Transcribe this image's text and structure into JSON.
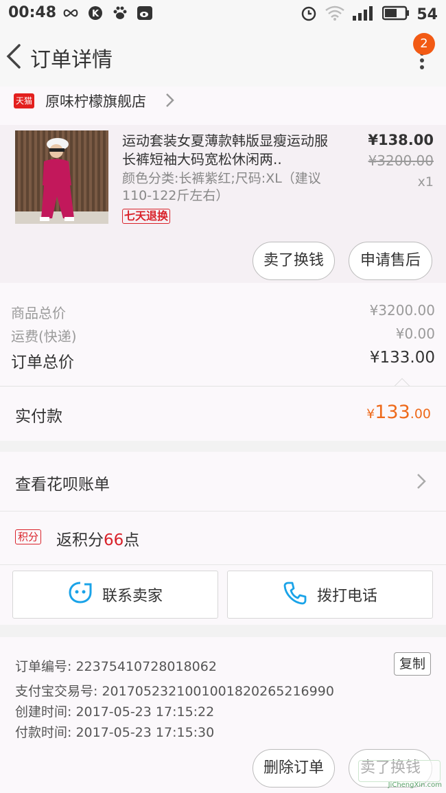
{
  "status": {
    "time": "00:48",
    "battery": "54"
  },
  "header": {
    "title": "订单详情",
    "badge": "2"
  },
  "shop": {
    "logo": "天猫",
    "name": "原味柠檬旗舰店"
  },
  "product": {
    "title": "运动套装女夏薄款韩版显瘦运动服长裤短袖大码宽松休闲两..",
    "sku": "颜色分类:长裤紫红;尺码:XL（建议110-122斤左右）",
    "tag": "七天退换",
    "price": "¥138.00",
    "orig_price": "¥3200.00",
    "qty": "x1",
    "btn_sell": "卖了换钱",
    "btn_aftersale": "申请售后"
  },
  "summary": {
    "goods_label": "商品总价",
    "goods_value": "¥3200.00",
    "ship_label": "运费(快递)",
    "ship_value": "¥0.00",
    "total_label": "订单总价",
    "total_value": "¥133.00"
  },
  "paid": {
    "label": "实付款",
    "yen": "¥",
    "int": "133",
    "dec": ".00"
  },
  "huabei": {
    "label": "查看花呗账单"
  },
  "points": {
    "tag": "积分",
    "prefix": "返积分",
    "num": "66",
    "suffix": "点"
  },
  "contacts": {
    "seller": "联系卖家",
    "call": "拨打电话"
  },
  "info": {
    "order_no": "订单编号: 22375410728018062",
    "alipay_no": "支付宝交易号: 2017052321001001820265216990",
    "created": "创建时间: 2017-05-23 17:15:22",
    "paid": "付款时间: 2017-05-23 17:15:30",
    "copy": "复制"
  },
  "footer": {
    "delete": "删除订单",
    "sell": "卖了换钱"
  },
  "watermark": "JiChengXin.com",
  "colors": {
    "accent": "#ee6a1b",
    "tmall_red": "#d9222a",
    "icon_blue": "#1aa3e8"
  }
}
